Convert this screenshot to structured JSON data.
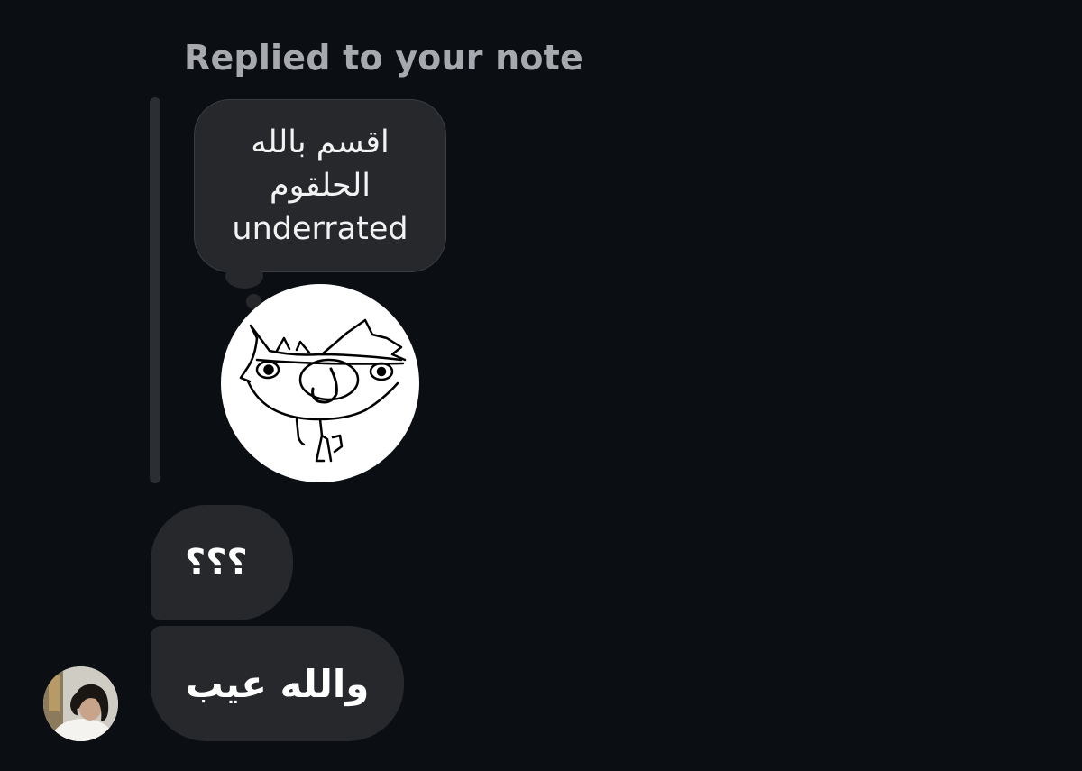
{
  "reply_context": {
    "header_text": "Replied to your note"
  },
  "note": {
    "lines": [
      "اقسم بالله",
      "الحلقوم",
      "underrated"
    ],
    "avatar_icon": "hand-drawn-cat-doodle"
  },
  "messages": [
    {
      "text": "؟؟؟"
    },
    {
      "text": "والله عيب"
    }
  ],
  "sender": {
    "avatar_icon": "profile-photo"
  },
  "colors": {
    "background": "#0b0f14",
    "bubble": "#26282c",
    "header_text": "#a7a9ae"
  }
}
